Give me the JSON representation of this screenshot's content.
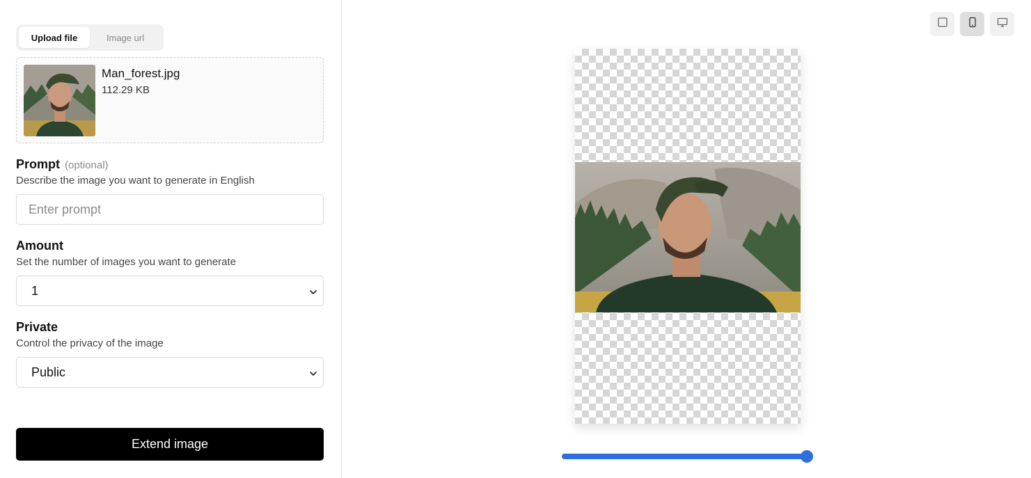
{
  "tabs": [
    {
      "label": "Upload file",
      "active": true
    },
    {
      "label": "Image url",
      "active": false
    }
  ],
  "upload": {
    "file_name": "Man_forest.jpg",
    "file_size": "112.29 KB"
  },
  "prompt": {
    "label": "Prompt",
    "optional": "(optional)",
    "description": "Describe the image you want to generate in English",
    "value": "",
    "placeholder": "Enter prompt"
  },
  "amount": {
    "label": "Amount",
    "description": "Set the number of images you want to generate",
    "value": "1"
  },
  "private": {
    "label": "Private",
    "description": "Control the privacy of the image",
    "value": "Public"
  },
  "submit": {
    "label": "Extend image"
  },
  "preview": {
    "view_modes": [
      {
        "icon": "square-icon",
        "active": false
      },
      {
        "icon": "phone-icon",
        "active": true
      },
      {
        "icon": "desktop-icon",
        "active": false
      }
    ],
    "slider_value": 1.0
  },
  "colors": {
    "accent": "#2f6fdb",
    "button_bg": "#000000"
  }
}
